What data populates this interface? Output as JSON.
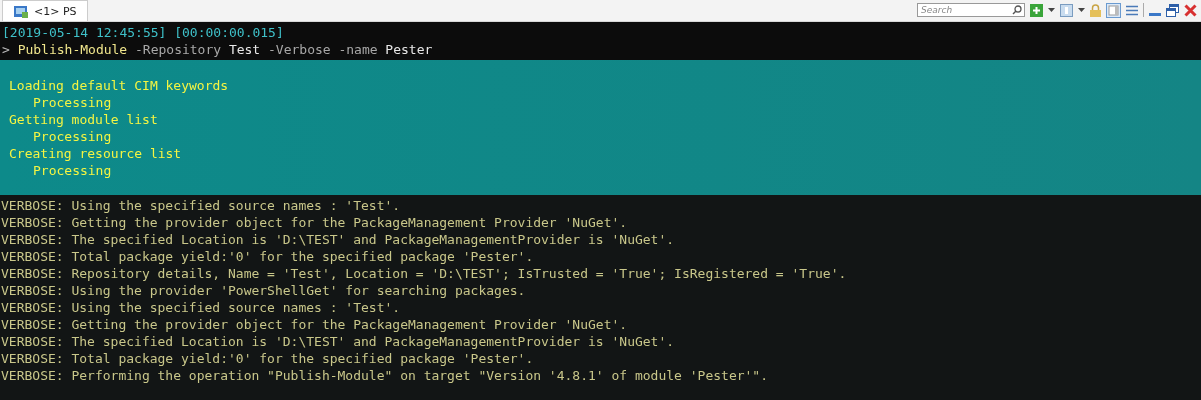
{
  "tabs": [
    {
      "label": "<1> PS",
      "selected": true
    }
  ],
  "toolbar": {
    "search": {
      "placeholder": "Search"
    }
  },
  "console": {
    "timestamp": "[2019-05-14 12:45:55] [00:00:00.015]",
    "command": [
      {
        "kind": "prompt",
        "text": ">"
      },
      {
        "kind": "cmdlet",
        "text": "Publish-Module"
      },
      {
        "kind": "param",
        "text": "-Repository"
      },
      {
        "kind": "arg",
        "text": "Test"
      },
      {
        "kind": "param",
        "text": "-Verbose"
      },
      {
        "kind": "param",
        "text": "-name"
      },
      {
        "kind": "arg",
        "text": "Pester"
      }
    ],
    "progress": [
      {
        "activity": "Loading default CIM keywords",
        "status": "Processing"
      },
      {
        "activity": "Getting module list",
        "status": "Processing"
      },
      {
        "activity": "Creating resource list",
        "status": "Processing"
      }
    ],
    "output": [
      "VERBOSE: Using the specified source names : 'Test'.",
      "VERBOSE: Getting the provider object for the PackageManagement Provider 'NuGet'.",
      "VERBOSE: The specified Location is 'D:\\TEST' and PackageManagementProvider is 'NuGet'.",
      "VERBOSE: Total package yield:'0' for the specified package 'Pester'.",
      "VERBOSE: Repository details, Name = 'Test', Location = 'D:\\TEST'; IsTrusted = 'True'; IsRegistered = 'True'.",
      "VERBOSE: Using the provider 'PowerShellGet' for searching packages.",
      "VERBOSE: Using the specified source names : 'Test'.",
      "VERBOSE: Getting the provider object for the PackageManagement Provider 'NuGet'.",
      "VERBOSE: The specified Location is 'D:\\TEST' and PackageManagementProvider is 'NuGet'.",
      "VERBOSE: Total package yield:'0' for the specified package 'Pester'.",
      "VERBOSE: Performing the operation \"Publish-Module\" on target \"Version '4.8.1' of module 'Pester'\"."
    ]
  }
}
